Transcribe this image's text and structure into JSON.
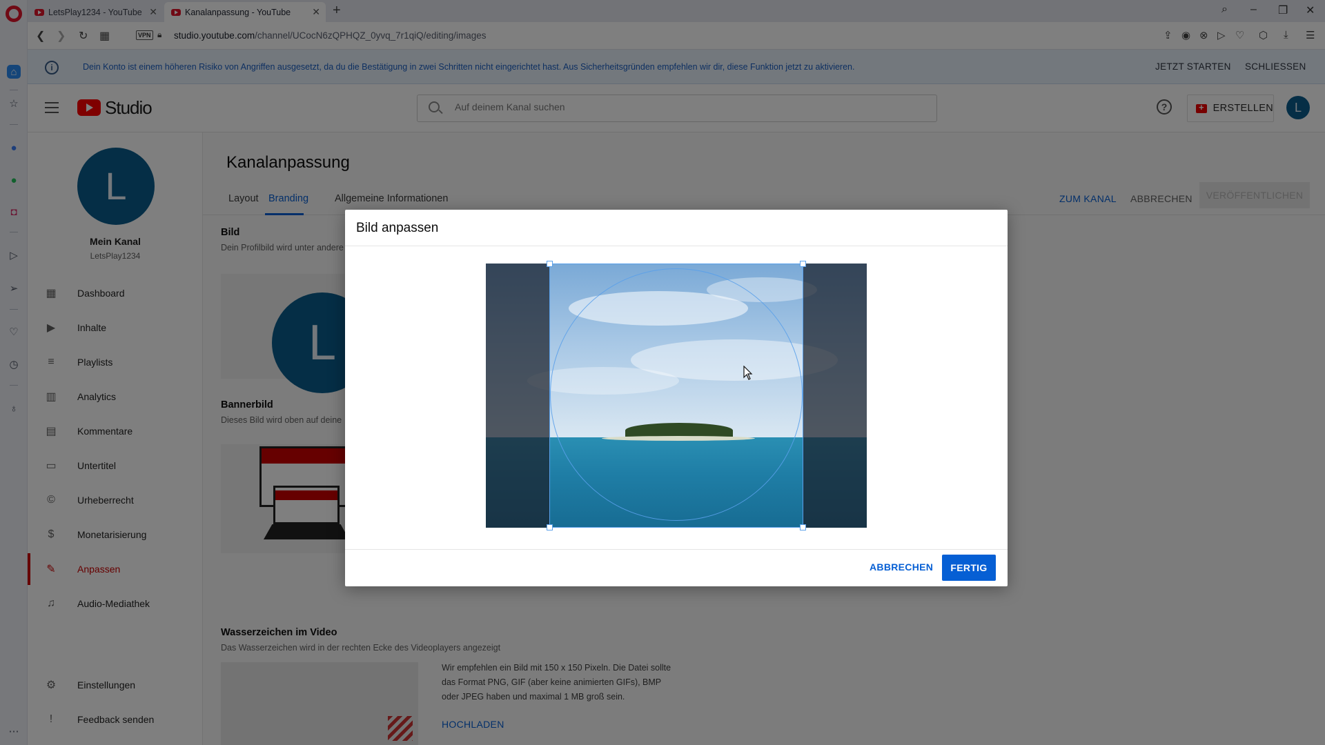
{
  "browser": {
    "tabs": [
      {
        "label": "LetsPlay1234 - YouTube"
      },
      {
        "label": "Kanalanpassung - YouTube"
      }
    ],
    "url_host": "studio.youtube.com",
    "url_path": "/channel/UCocN6zQPHQZ_0yvq_7r1qiQ/editing/images",
    "vpn_label": "VPN"
  },
  "notice": {
    "message": "Dein Konto ist einem höheren Risiko von Angriffen ausgesetzt, da du die Bestätigung in zwei Schritten nicht eingerichtet hast. Aus Sicherheitsgründen empfehlen wir dir, diese Funktion jetzt zu aktivieren.",
    "start_label": "JETZT STARTEN",
    "close_label": "SCHLIESSEN"
  },
  "header": {
    "logo_text": "Studio",
    "search_placeholder": "Auf deinem Kanal suchen",
    "create_label": "ERSTELLEN",
    "avatar_letter": "L"
  },
  "channel": {
    "avatar_letter": "L",
    "title": "Mein Kanal",
    "handle": "LetsPlay1234"
  },
  "nav": {
    "items": [
      {
        "label": "Dashboard"
      },
      {
        "label": "Inhalte"
      },
      {
        "label": "Playlists"
      },
      {
        "label": "Analytics"
      },
      {
        "label": "Kommentare"
      },
      {
        "label": "Untertitel"
      },
      {
        "label": "Urheberrecht"
      },
      {
        "label": "Monetarisierung"
      },
      {
        "label": "Anpassen"
      },
      {
        "label": "Audio-Mediathek"
      }
    ],
    "settings_label": "Einstellungen",
    "feedback_label": "Feedback senden"
  },
  "main": {
    "title": "Kanalanpassung",
    "tabs": [
      {
        "label": "Layout"
      },
      {
        "label": "Branding"
      },
      {
        "label": "Allgemeine Informationen"
      }
    ],
    "to_channel_label": "ZUM KANAL",
    "cancel_label": "ABBRECHEN",
    "publish_label": "VERÖFFENTLICHEN",
    "picture_title": "Bild",
    "picture_desc": "Dein Profilbild wird unter andere",
    "picture_letter": "L",
    "banner_title": "Bannerbild",
    "banner_desc": "Dieses Bild wird oben auf deine",
    "watermark_title": "Wasserzeichen im Video",
    "watermark_desc": "Das Wasserzeichen wird in der rechten Ecke des Videoplayers angezeigt",
    "watermark_hint": "Wir empfehlen ein Bild mit 150 x 150 Pixeln. Die Datei sollte das Format PNG, GIF (aber keine animierten GIFs), BMP oder JPEG haben und maximal 1 MB groß sein.",
    "upload_label": "HOCHLADEN"
  },
  "dialog": {
    "title": "Bild anpassen",
    "cancel_label": "ABBRECHEN",
    "done_label": "FERTIG"
  },
  "colors": {
    "accent": "#065fd4",
    "active_nav": "#cc0000",
    "avatar": "#0b5d8c"
  }
}
